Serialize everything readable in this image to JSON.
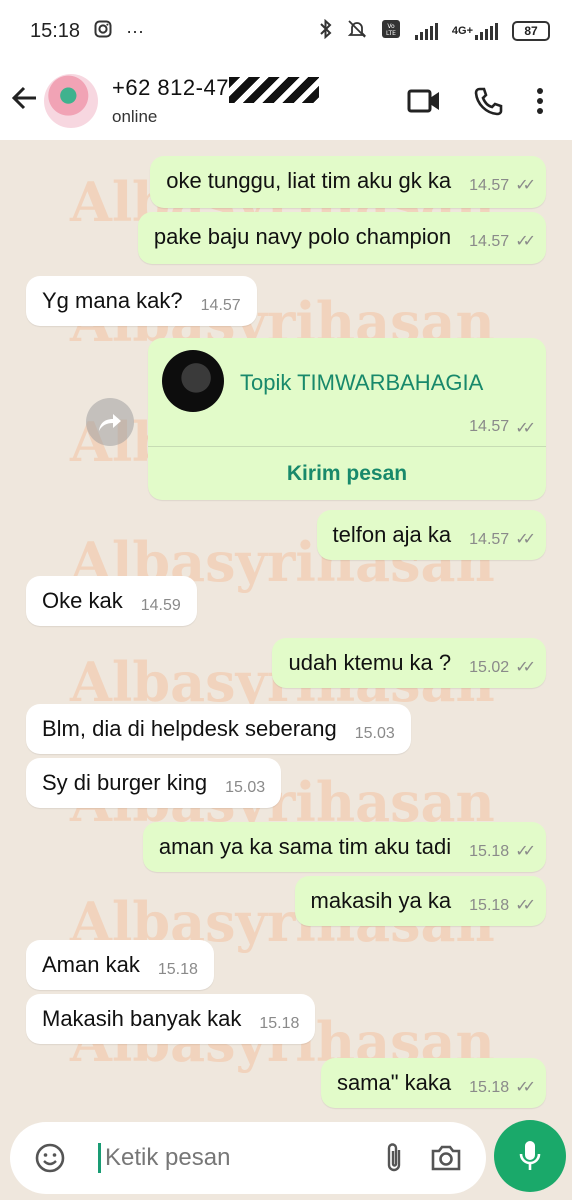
{
  "status_bar": {
    "time": "15:18",
    "network": "4G+",
    "battery": "87"
  },
  "header": {
    "contact_name": "+62 812-47",
    "contact_status": "online"
  },
  "watermark_text": "Albasyrihasan",
  "messages": [
    {
      "dir": "out",
      "text": "oke tunggu, liat tim aku gk ka",
      "time": "14.57"
    },
    {
      "dir": "out",
      "text": "pake baju navy polo champion",
      "time": "14.57"
    },
    {
      "dir": "in",
      "text": "Yg mana kak?",
      "time": "14.57"
    },
    {
      "dir": "out",
      "text": "telfon aja ka",
      "time": "14.57"
    },
    {
      "dir": "in",
      "text": "Oke kak",
      "time": "14.59"
    },
    {
      "dir": "out",
      "text": "udah ktemu ka ?",
      "time": "15.02"
    },
    {
      "dir": "in",
      "text": "Blm, dia di helpdesk seberang",
      "time": "15.03"
    },
    {
      "dir": "in",
      "text": "Sy di burger king",
      "time": "15.03"
    },
    {
      "dir": "out",
      "text": "aman ya ka sama tim aku tadi",
      "time": "15.18"
    },
    {
      "dir": "out",
      "text": "makasih ya ka",
      "time": "15.18"
    },
    {
      "dir": "in",
      "text": "Aman kak",
      "time": "15.18"
    },
    {
      "dir": "in",
      "text": "Makasih banyak kak",
      "time": "15.18"
    },
    {
      "dir": "out",
      "text": "sama\" kaka",
      "time": "15.18"
    }
  ],
  "link_card": {
    "title": "Topik TIMWARBAHAGIA",
    "time": "14.57",
    "action": "Kirim pesan"
  },
  "input": {
    "placeholder": "Ketik pesan"
  },
  "colors": {
    "outgoing_bubble": "#e2fbc9",
    "incoming_bubble": "#ffffff",
    "accent_green": "#1aa96a",
    "chat_background": "#efe7dd"
  }
}
